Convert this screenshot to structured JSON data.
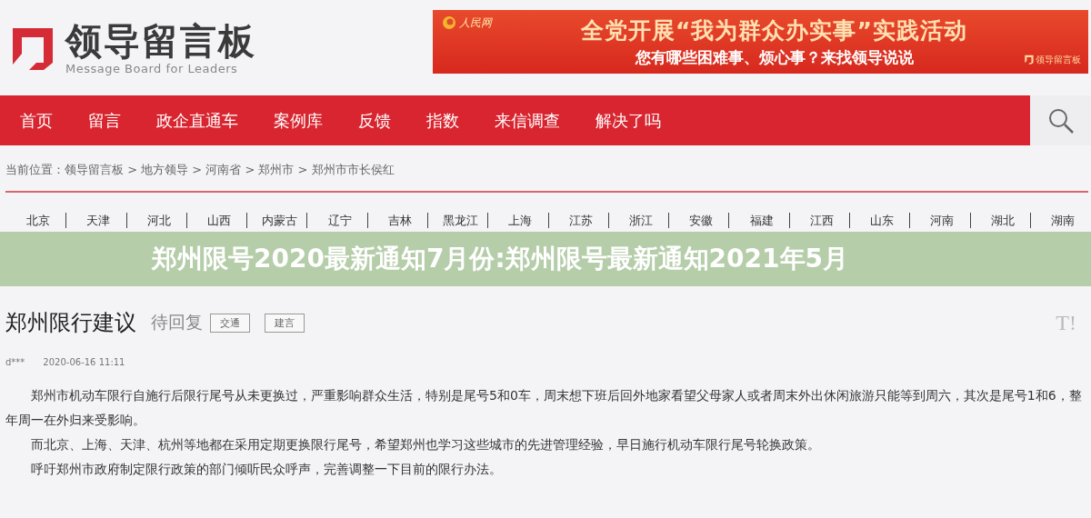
{
  "header": {
    "logo_title": "领导留言板",
    "logo_subtitle": "Message Board for Leaders",
    "banner": {
      "logo_text": "人民网",
      "headline": "全党开展“我为群众办实事”实践活动",
      "subline": "您有哪些困难事、烦心事？来找领导说说",
      "badge_text": "领导留言板"
    }
  },
  "nav": {
    "items": [
      "首页",
      "留言",
      "政企直通车",
      "案例库",
      "反馈",
      "指数",
      "来信调查",
      "解决了吗"
    ]
  },
  "breadcrumb": "当前位置：领导留言板 > 地方领导 > 河南省 > 郑州市 > 郑州市市长侯红",
  "provinces": [
    [
      "北京",
      "天津",
      "河北",
      "山西",
      "内蒙古",
      "辽宁",
      "吉林",
      "黑龙江",
      "上海",
      "江苏",
      "浙江",
      "安徽",
      "福建",
      "江西",
      "山东",
      "河南",
      "湖北",
      "湖南"
    ]
  ],
  "overlay_title": "郑州限号2020最新通知7月份:郑州限号最新通知2021年5月",
  "message": {
    "title": "郑州限行建议",
    "status": "待回复",
    "tags": [
      "交通",
      "建言"
    ],
    "font_button": "T!",
    "author": "d***",
    "date": "2020-06-16 11:11",
    "paragraphs": [
      "郑州市机动车限行自施行后限行尾号从未更换过，严重影响群众生活，特别是尾号5和0车，周末想下班后回外地家看望父母家人或者周末外出休闲旅游只能等到周六，其次是尾号1和6，整年周一在外归来受影响。",
      "而北京、上海、天津、杭州等地都在采用定期更换限行尾号，希望郑州也学习这些城市的先进管理经验，早日施行机动车限行尾号轮换政策。",
      "呼吁郑州市政府制定限行政策的部门倾听民众呼声，完善调整一下目前的限行办法。"
    ]
  }
}
